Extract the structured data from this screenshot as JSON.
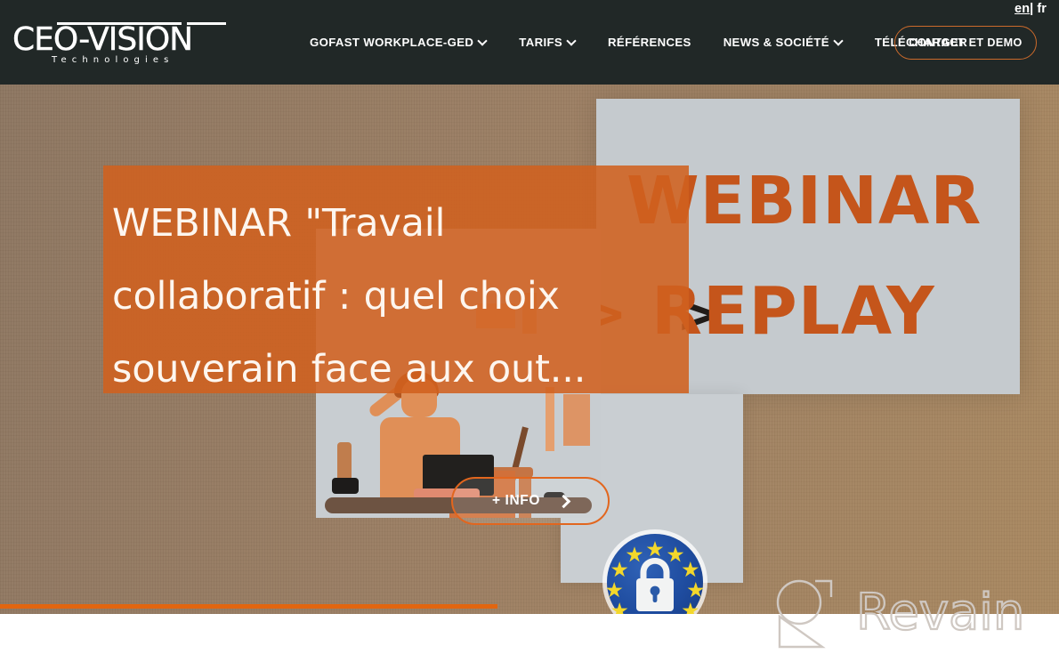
{
  "site": {
    "logo_main": "CEO-VISION",
    "logo_sub": "Technologies"
  },
  "language_switcher": {
    "en_label": "en",
    "separator": "|",
    "fr_label": "fr"
  },
  "nav": {
    "items": [
      {
        "label": "GOFAST WORKPLACE-GED",
        "has_dropdown": true
      },
      {
        "label": "TARIFS",
        "has_dropdown": true
      },
      {
        "label": "RÉFÉRENCES",
        "has_dropdown": false
      },
      {
        "label": "NEWS & SOCIÉTÉ",
        "has_dropdown": true
      },
      {
        "label": "TÉLÉCHARGER",
        "has_dropdown": false
      }
    ],
    "cta_label": "CONTACT ET DEMO"
  },
  "hero": {
    "headline": "WEBINAR \"Travail collaboratif : quel choix souverain face aux out...",
    "info_button_label": "+ INFO",
    "board_line1": "WEBINAR",
    "board_line2": "REPLAY",
    "board_chevrons": ">>",
    "board_chevron_dark": ">",
    "progress_percent": 47
  },
  "watermark": {
    "text": "Revain"
  },
  "colors": {
    "header_bg": "#212827",
    "accent_orange": "#e2650f",
    "cta_border": "#cb6a2b",
    "headline_panel": "rgba(208, 97, 31, 0.88)",
    "hero_bg": "#9a7d62",
    "board_bg": "#c5cace",
    "board_text": "#c5551b"
  }
}
